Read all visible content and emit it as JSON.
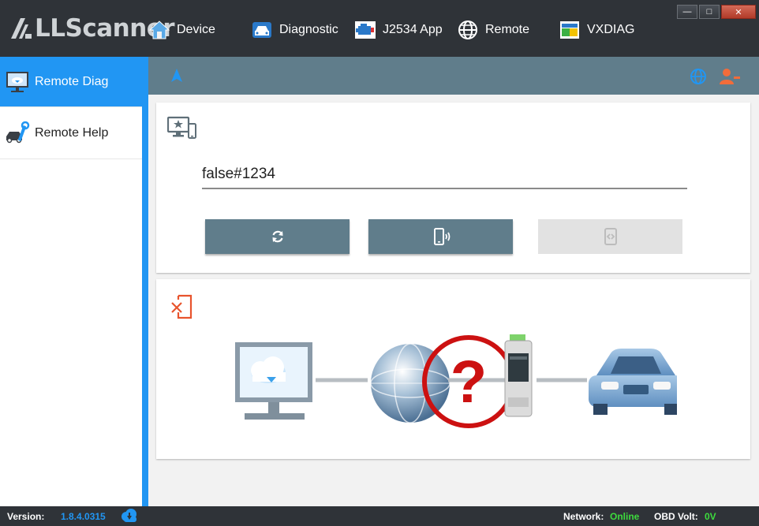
{
  "app": {
    "logo_text": "LLScanner"
  },
  "menu": {
    "device": "Device",
    "diagnostic": "Diagnostic",
    "j2534": "J2534 App",
    "remote": "Remote",
    "vxdiag": "VXDIAG"
  },
  "window_controls": {
    "minimize": "—",
    "maximize": "□",
    "close": "✕"
  },
  "sidebar": {
    "items": [
      {
        "label": "Remote Diag",
        "icon": "monitor-cloud-icon",
        "active": true
      },
      {
        "label": "Remote Help",
        "icon": "wrench-car-icon",
        "active": false
      }
    ]
  },
  "connection": {
    "code_value": "false#1234",
    "buttons": [
      {
        "icon": "refresh-icon",
        "enabled": true
      },
      {
        "icon": "phone-vibrate-icon",
        "enabled": true
      },
      {
        "icon": "connect-icon",
        "enabled": false
      }
    ]
  },
  "status": {
    "version_label": "Version:",
    "version_value": "1.8.4.0315",
    "network_label": "Network:",
    "network_value": "Online",
    "obd_label": "OBD Volt:",
    "obd_value": "0V"
  },
  "colors": {
    "accent": "#2196f3",
    "header": "#607d8b",
    "titlebar": "#2f3338",
    "online": "#3ddc3d",
    "error": "#cc1111",
    "warning_icon": "#e8542d"
  }
}
